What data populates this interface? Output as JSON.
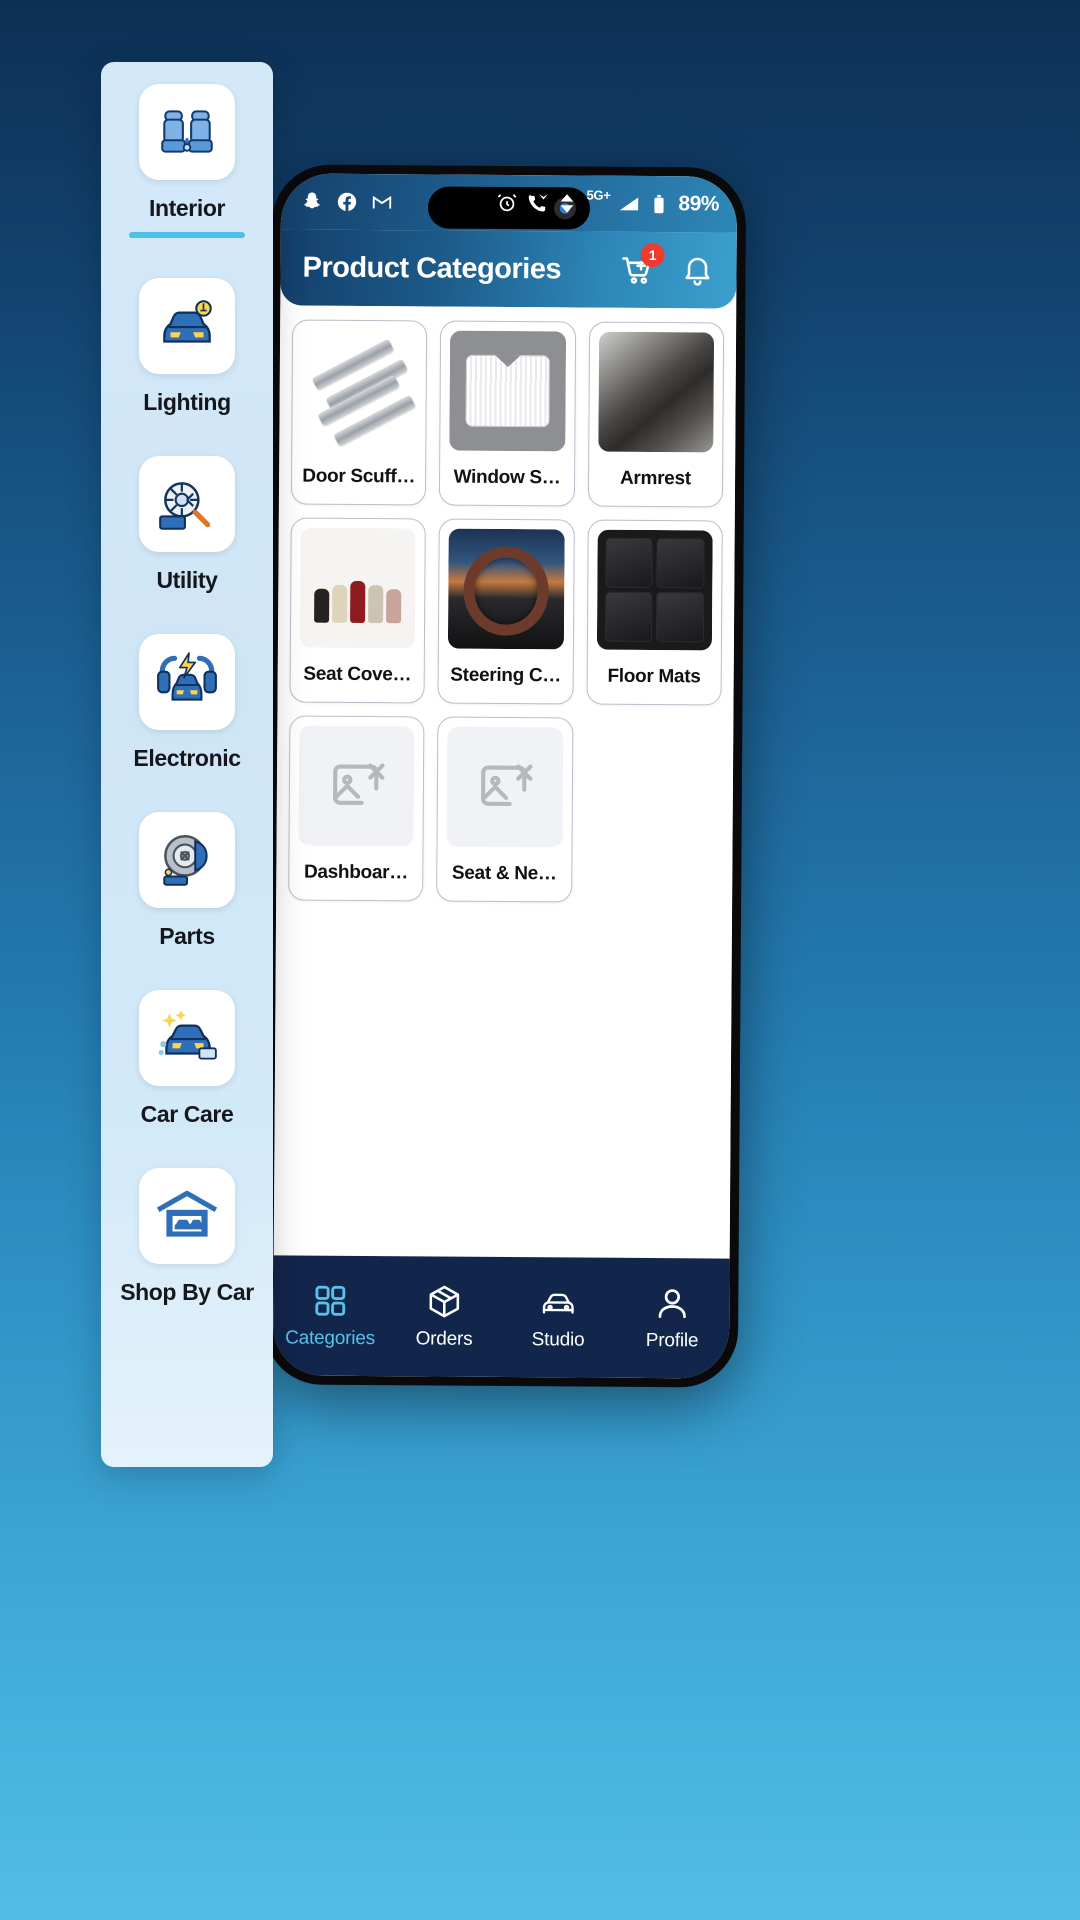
{
  "statusbar": {
    "left_icons": [
      "snapchat-icon",
      "facebook-icon",
      "gmail-icon"
    ],
    "alarm_icon": "alarm-icon",
    "call_wifi_icon": "call-wifi-icon",
    "data-transfer_icon": "data-transfer-icon",
    "network_label": "5G+",
    "signal_icon": "signal-bars-icon",
    "battery_icon": "battery-icon",
    "battery_label": "89%"
  },
  "header": {
    "title": "Product Categories",
    "cart_icon": "cart-icon",
    "cart_badge": "1",
    "bell_icon": "bell-icon"
  },
  "products": [
    {
      "label": "Door Scuff…",
      "image": "door-scuff-plates",
      "broken": false
    },
    {
      "label": "Window S…",
      "image": "window-sunshade",
      "broken": false
    },
    {
      "label": "Armrest",
      "image": "car-armrest",
      "broken": false
    },
    {
      "label": "Seat Cove…",
      "image": "seat-covers",
      "broken": false
    },
    {
      "label": "Steering C…",
      "image": "steering-cover",
      "broken": false
    },
    {
      "label": "Floor Mats",
      "image": "floor-mats",
      "broken": false
    },
    {
      "label": "Dashboar…",
      "image": "broken-image",
      "broken": true
    },
    {
      "label": "Seat & Ne…",
      "image": "broken-image",
      "broken": true
    }
  ],
  "bottom_nav": {
    "items": [
      {
        "label": "Categories",
        "icon": "grid-icon",
        "active": true
      },
      {
        "label": "Orders",
        "icon": "package-icon",
        "active": false
      },
      {
        "label": "Studio",
        "icon": "car-icon",
        "active": false
      },
      {
        "label": "Profile",
        "icon": "person-icon",
        "active": false
      }
    ]
  },
  "sidebar": {
    "items": [
      {
        "label": "Interior",
        "icon": "car-seats-icon",
        "active": true
      },
      {
        "label": "Lighting",
        "icon": "car-light-icon",
        "active": false
      },
      {
        "label": "Utility",
        "icon": "car-tools-icon",
        "active": false
      },
      {
        "label": "Electronic",
        "icon": "car-electric-icon",
        "active": false
      },
      {
        "label": "Parts",
        "icon": "brake-disc-icon",
        "active": false
      },
      {
        "label": "Car Care",
        "icon": "car-wash-icon",
        "active": false
      },
      {
        "label": "Shop By Car",
        "icon": "garage-icon",
        "active": false
      }
    ]
  },
  "colors": {
    "accent": "#4fc0e8",
    "nav_bg": "#12254b",
    "badge": "#ef3b2d",
    "header_gradient_start": "#143f6b",
    "header_gradient_end": "#3ba0cd"
  }
}
